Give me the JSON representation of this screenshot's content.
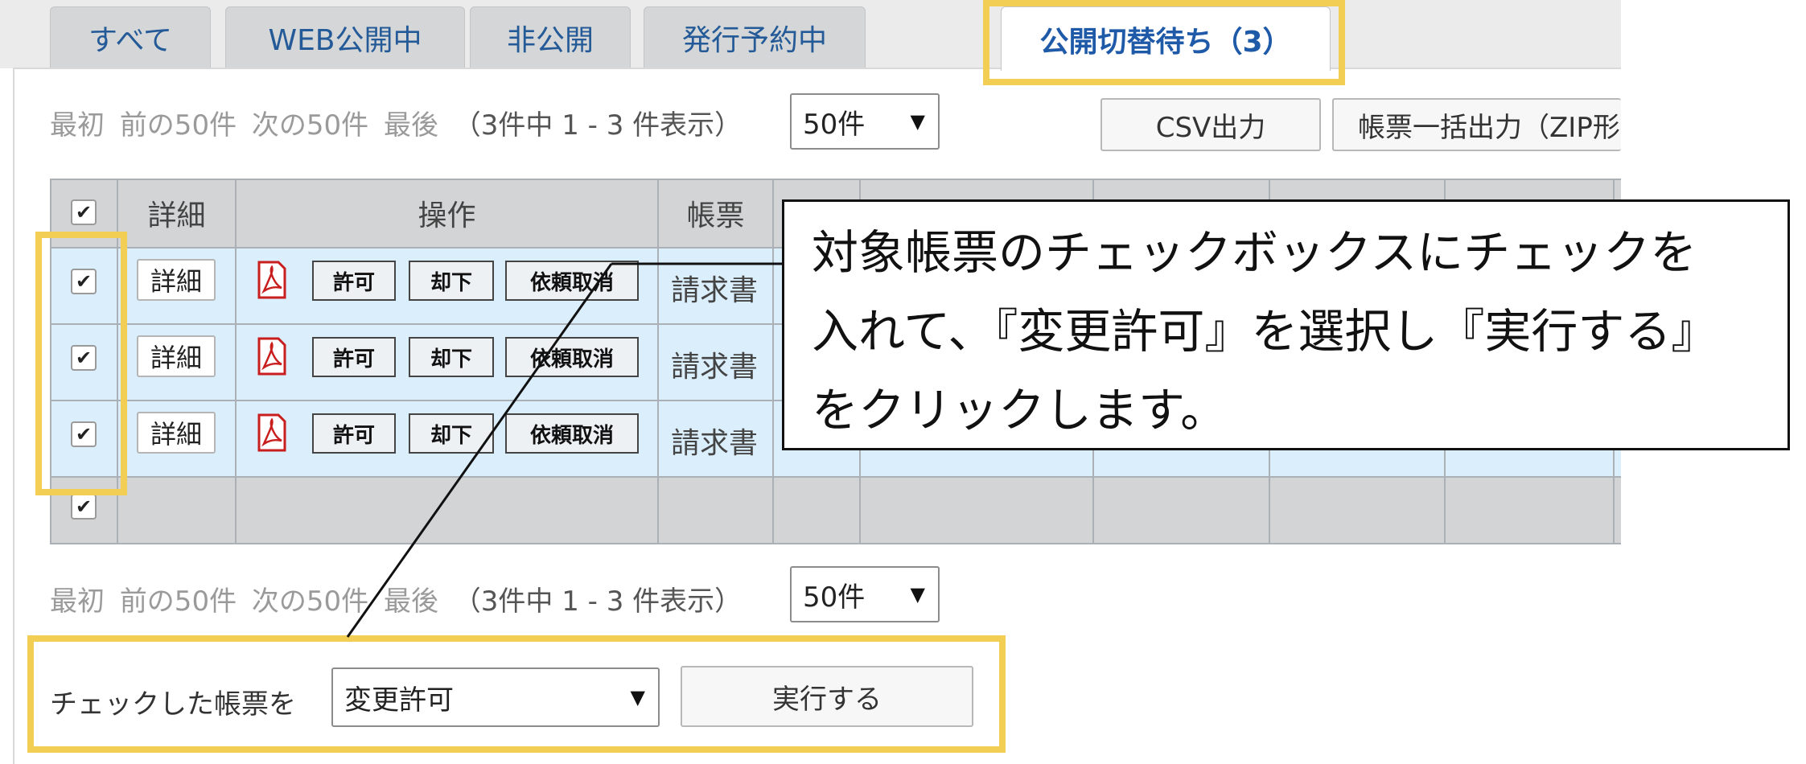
{
  "tabs": [
    {
      "label": "すべて"
    },
    {
      "label": "WEB公開中"
    },
    {
      "label": "非公開"
    },
    {
      "label": "発行予約中"
    },
    {
      "label": "公開切替待ち（3）"
    }
  ],
  "pager": {
    "first": "最初",
    "prev": "前の50件",
    "next": "次の50件",
    "last": "最後",
    "summary": "（3件中 1 - 3 件表示）",
    "per_page": "50件"
  },
  "toolbar": {
    "csv": "CSV出力",
    "bulk": "帳票一括出力（ZIP形"
  },
  "table": {
    "headers": {
      "detail": "詳細",
      "operation": "操作",
      "doc": "帳票"
    },
    "rows": [
      {
        "detail": "詳細",
        "approve": "許可",
        "reject": "却下",
        "cancel": "依頼取消",
        "doc": "請求書"
      },
      {
        "detail": "詳細",
        "approve": "許可",
        "reject": "却下",
        "cancel": "依頼取消",
        "doc": "請求書"
      },
      {
        "detail": "詳細",
        "approve": "許可",
        "reject": "却下",
        "cancel": "依頼取消",
        "doc": "請求書"
      }
    ],
    "check_mark": "✔"
  },
  "callout": {
    "line1": "対象帳票のチェックボックスにチェックを",
    "line2": "入れて、『変更許可』を選択し『実行する』",
    "line3": "をクリックします。"
  },
  "bulk_action": {
    "label": "チェックした帳票を",
    "selected": "変更許可",
    "execute": "実行する"
  },
  "icons": {
    "dropdown": "▼",
    "pdf": "pdf-icon"
  },
  "colors": {
    "highlight": "#f2cf54",
    "row_bg": "#dbeefc",
    "tab_text": "#245a97"
  }
}
